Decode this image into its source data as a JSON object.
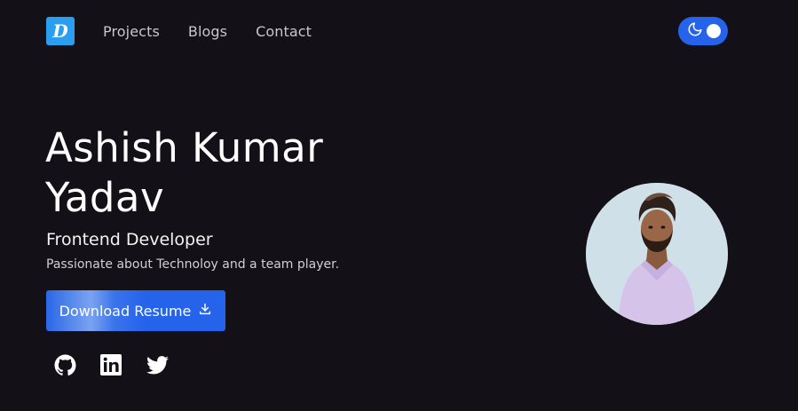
{
  "nav": {
    "logo_letter": "D",
    "links": [
      "Projects",
      "Blogs",
      "Contact"
    ],
    "theme_toggle_icon": "moon-icon"
  },
  "hero": {
    "name": "Ashish Kumar Yadav",
    "role": "Frontend Developer",
    "tagline": "Passionate about Technoloy and a team player.",
    "resume_button_label": "Download Resume",
    "resume_button_icon": "download-icon"
  },
  "socials": [
    {
      "icon": "github-icon"
    },
    {
      "icon": "linkedin-icon"
    },
    {
      "icon": "twitter-icon"
    }
  ],
  "colors": {
    "background": "#131117",
    "accent": "#2563eb",
    "logo": "#2b9ef0",
    "avatar_bg": "#cfe0e8"
  }
}
